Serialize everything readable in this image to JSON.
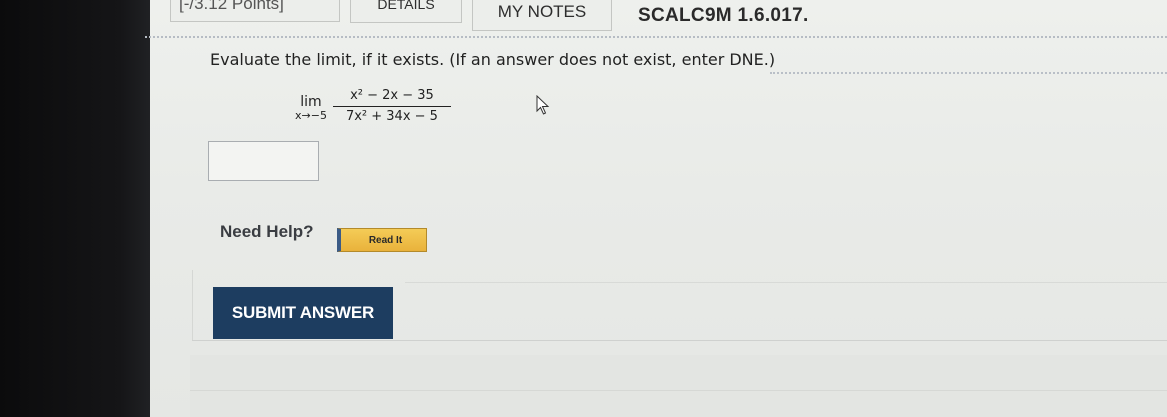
{
  "tabs": {
    "points_label": "[-/3.12 Points]",
    "details_label": "DETAILS",
    "notes_label": "MY NOTES"
  },
  "assignment": {
    "id": "SCALC9M 1.6.017."
  },
  "question": {
    "prompt": "Evaluate the limit, if it exists. (If an answer does not exist, enter DNE.)",
    "lim_word": "lim",
    "lim_sub": "x→−5",
    "numerator": "x² − 2x − 35",
    "denominator": "7x² + 34x − 5"
  },
  "answer": {
    "value": ""
  },
  "help": {
    "label": "Need Help?",
    "read_it_label": "Read It"
  },
  "actions": {
    "submit_label": "SUBMIT ANSWER"
  },
  "colors": {
    "submit_bg": "#1d3d60",
    "read_it_bg": "#e9b23b",
    "bezel": "#0b0b0c"
  },
  "icons": {
    "cursor": "mouse-pointer-icon"
  }
}
